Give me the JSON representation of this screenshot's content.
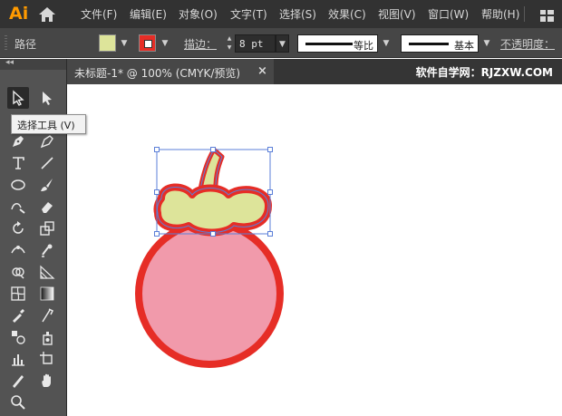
{
  "app": {
    "logo": "Ai",
    "menu": [
      {
        "label": "文件(F)"
      },
      {
        "label": "编辑(E)"
      },
      {
        "label": "对象(O)"
      },
      {
        "label": "文字(T)"
      },
      {
        "label": "选择(S)"
      },
      {
        "label": "效果(C)"
      },
      {
        "label": "视图(V)"
      },
      {
        "label": "窗口(W)"
      },
      {
        "label": "帮助(H)"
      }
    ]
  },
  "control": {
    "selection_label": "路径",
    "fill_color": "#dde49a",
    "stroke_color": "#e62d26",
    "stroke_label": "描边：",
    "stroke_weight": "8 pt",
    "profile_label": "等比",
    "brush_label": "基本",
    "opacity_label": "不透明度："
  },
  "toolbar": {
    "collapse_label": "◂◂",
    "tooltip": "选择工具 (V)",
    "tools": [
      {
        "icon": "selection-icon"
      },
      {
        "icon": "direct-selection-icon"
      },
      {
        "icon": "pen-icon"
      },
      {
        "icon": "curvature-icon"
      },
      {
        "icon": "type-icon"
      },
      {
        "icon": "line-segment-icon"
      },
      {
        "icon": "ellipse-icon"
      },
      {
        "icon": "paintbrush-icon"
      },
      {
        "icon": "shaper-icon"
      },
      {
        "icon": "eraser-icon"
      },
      {
        "icon": "rotate-icon"
      },
      {
        "icon": "scale-icon"
      },
      {
        "icon": "width-icon"
      },
      {
        "icon": "puppet-warp-icon"
      },
      {
        "icon": "shape-builder-icon"
      },
      {
        "icon": "perspective-grid-icon"
      },
      {
        "icon": "mesh-icon"
      },
      {
        "icon": "gradient-icon"
      },
      {
        "icon": "eyedropper-icon"
      },
      {
        "icon": "measure-icon"
      },
      {
        "icon": "blend-icon"
      },
      {
        "icon": "symbol-sprayer-icon"
      },
      {
        "icon": "column-graph-icon"
      },
      {
        "icon": "artboard-icon"
      },
      {
        "icon": "slice-icon"
      },
      {
        "icon": "hand-icon"
      },
      {
        "icon": "zoom-icon"
      }
    ]
  },
  "document": {
    "tab_title": "未标题-1* @ 100% (CMYK/预览)",
    "close_label": "×",
    "watermark": "软件自学网：RJZXW.COM"
  },
  "artwork": {
    "body_fill": "#f19aab",
    "outline_color": "#e62d26",
    "cap_fill": "#dde49a",
    "selection_color": "#5b7fd8"
  }
}
